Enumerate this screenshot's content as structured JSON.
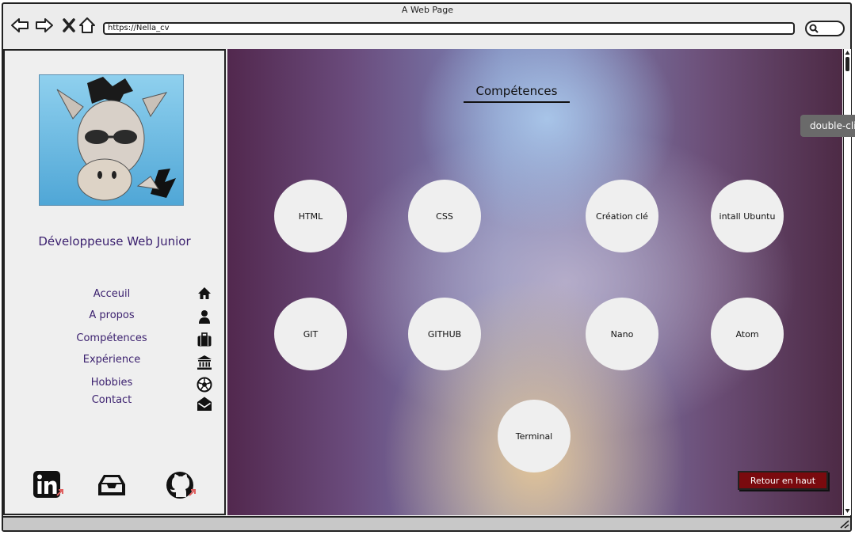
{
  "window": {
    "title": "A Web Page"
  },
  "browser": {
    "url": "https://Nella_cv"
  },
  "profile": {
    "role": "Développeuse Web Junior"
  },
  "menu": [
    {
      "label": "Acceuil",
      "icon": "home-icon"
    },
    {
      "label": "A propos",
      "icon": "user-icon"
    },
    {
      "label": "Compétences",
      "icon": "briefcase-icon"
    },
    {
      "label": "Expérience",
      "icon": "bank-icon"
    },
    {
      "label": "Hobbies",
      "icon": "soccer-ball-icon"
    },
    {
      "label": "Contact",
      "icon": "envelope-icon"
    }
  ],
  "social": [
    "linkedin-icon",
    "inbox-icon",
    "github-icon"
  ],
  "main": {
    "section_title": "Compétences",
    "skills": [
      "HTML",
      "CSS",
      "Création clé",
      "intall Ubuntu",
      "GIT",
      "GITHUB",
      "Nano",
      "Atom",
      "Terminal"
    ],
    "back_to_top": "Retour en haut"
  },
  "tooltip": "double-clic",
  "colors": {
    "menu_text": "#3a1f6e",
    "back_button": "#7a0a0e"
  }
}
